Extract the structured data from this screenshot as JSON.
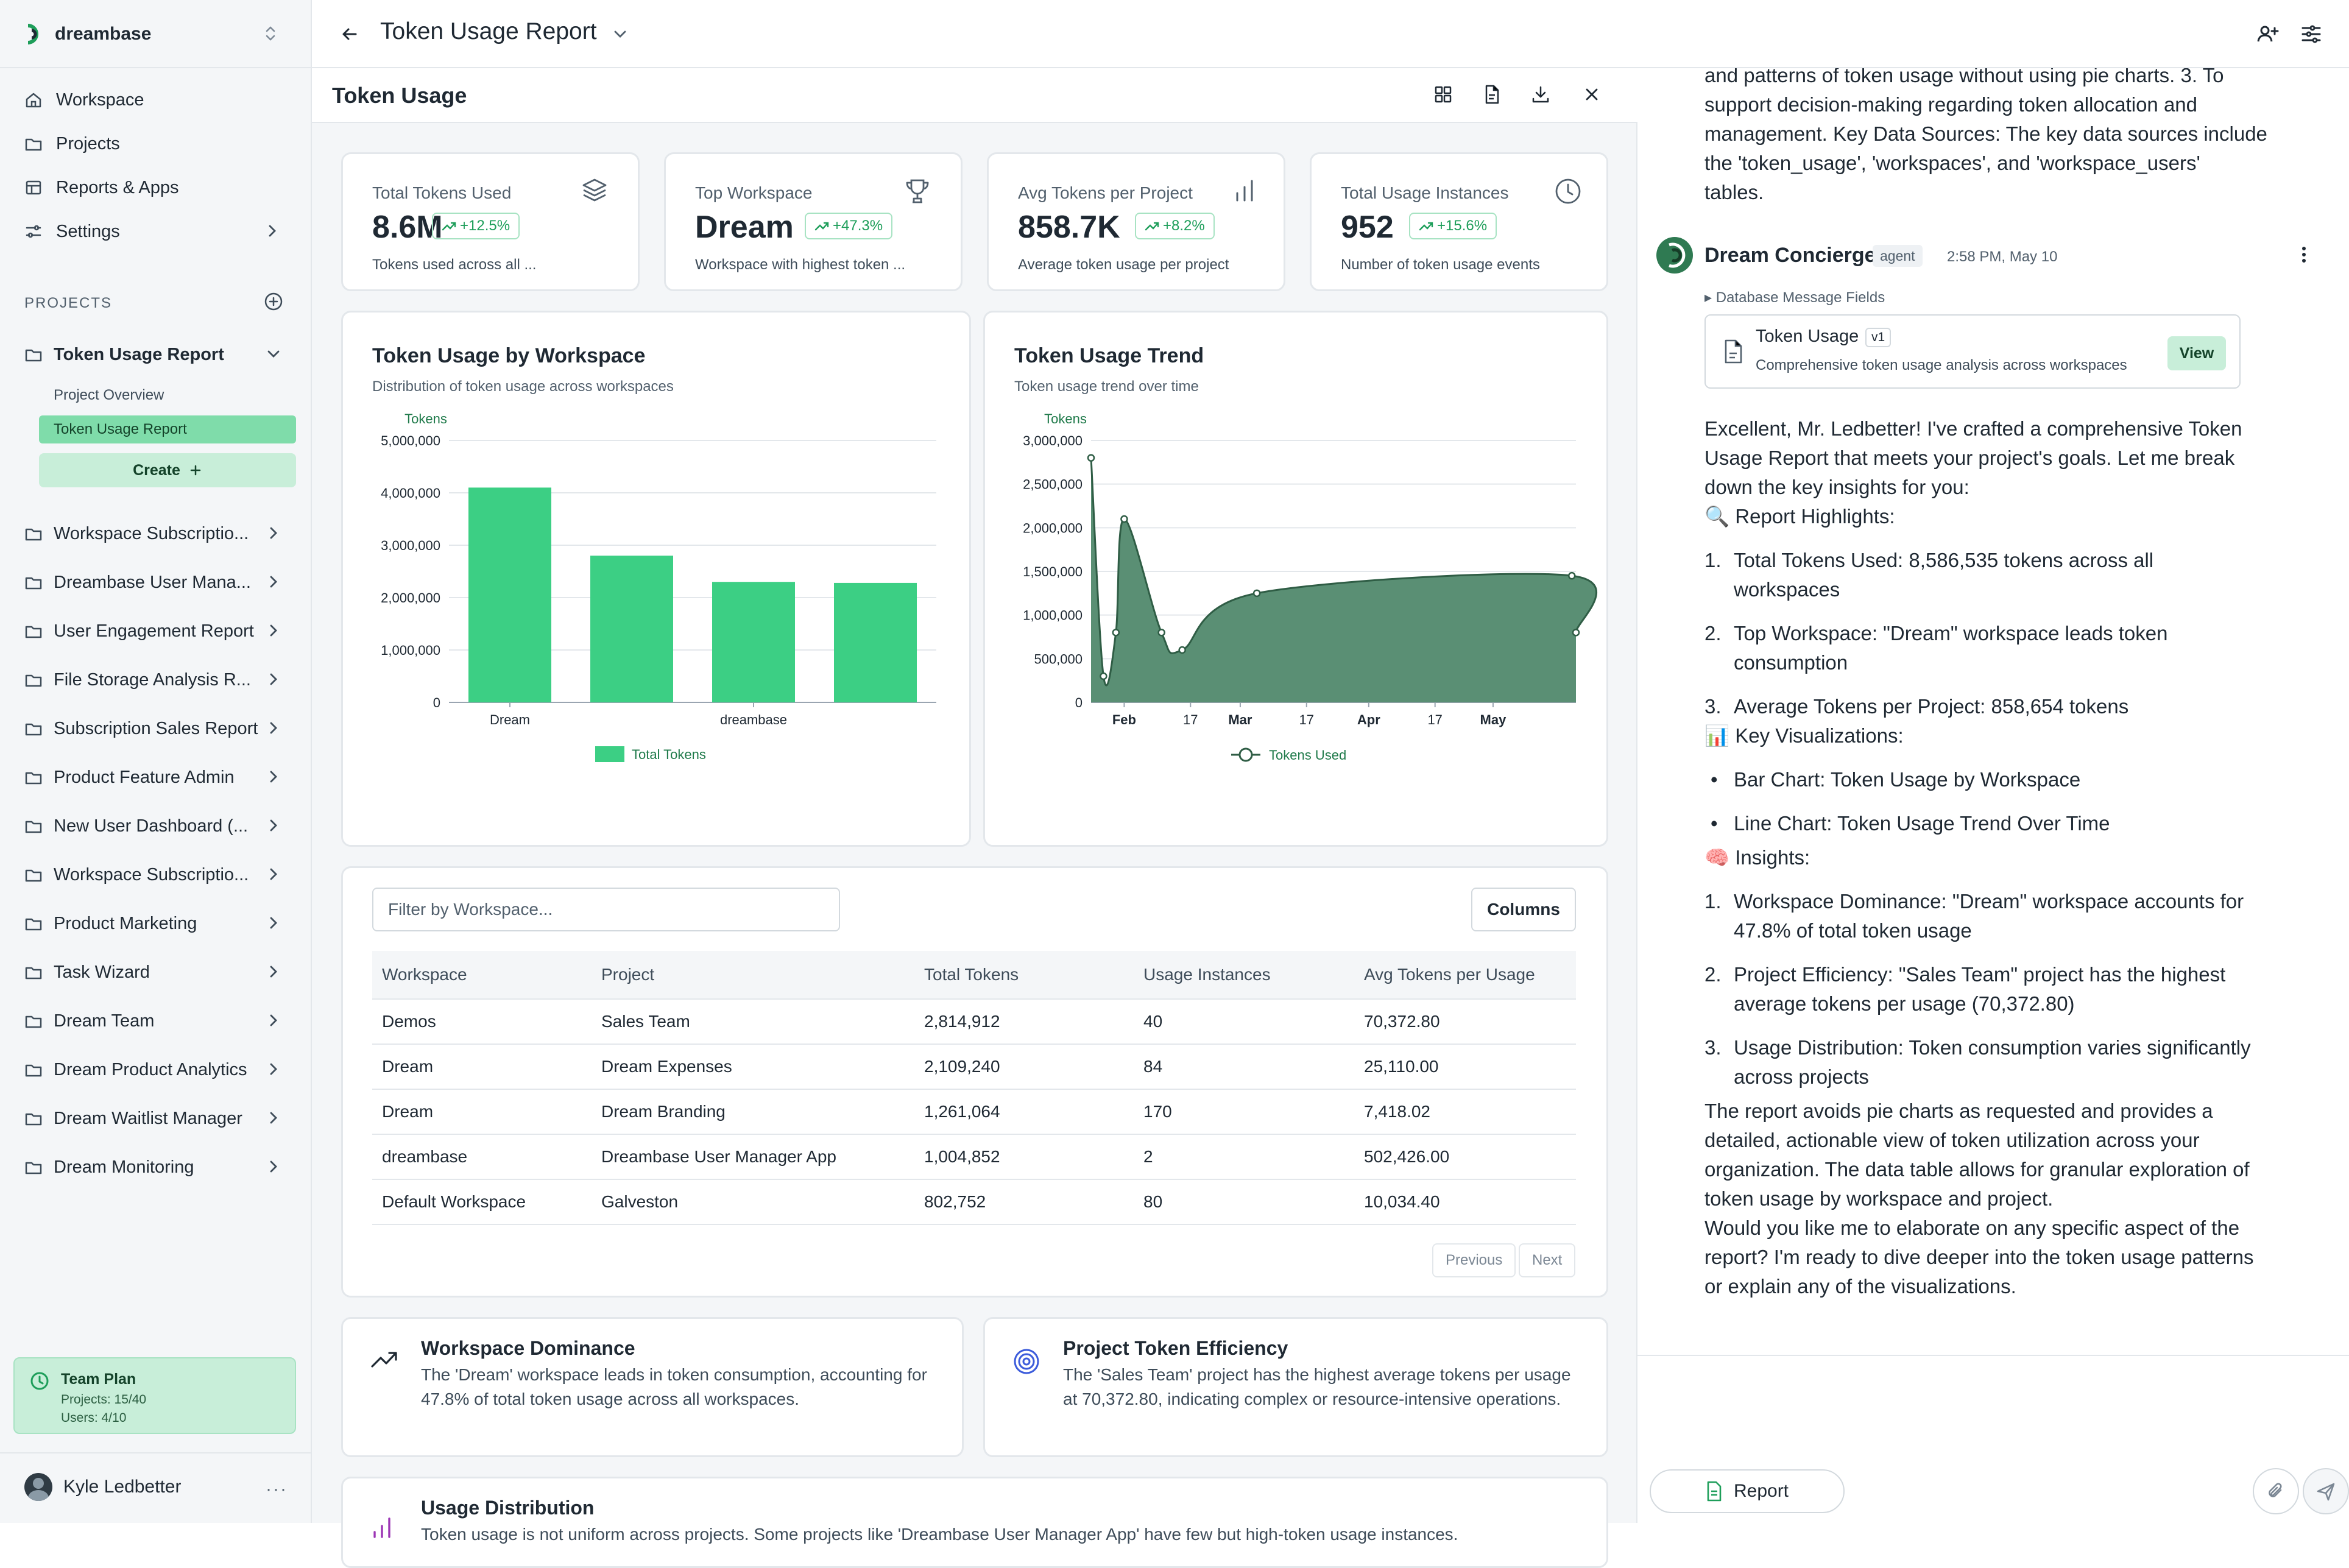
{
  "app": {
    "brand_name": "dreambase",
    "nav": [
      {
        "label": "Workspace",
        "icon": "home-icon"
      },
      {
        "label": "Projects",
        "icon": "folder-icon"
      },
      {
        "label": "Reports & Apps",
        "icon": "layout-icon"
      },
      {
        "label": "Settings",
        "icon": "sliders-icon"
      }
    ],
    "projects_label": "PROJECTS",
    "projects": [
      {
        "label": "Token Usage Report",
        "expanded": true
      },
      {
        "label": "Workspace Subscriptio..."
      },
      {
        "label": "Dreambase User Mana..."
      },
      {
        "label": "User Engagement Report"
      },
      {
        "label": "File Storage Analysis R..."
      },
      {
        "label": "Subscription Sales Report"
      },
      {
        "label": "Product Feature Admin"
      },
      {
        "label": "New User Dashboard (..."
      },
      {
        "label": "Workspace Subscriptio..."
      },
      {
        "label": "Product Marketing"
      },
      {
        "label": "Task Wizard"
      },
      {
        "label": "Dream Team"
      },
      {
        "label": "Dream Product Analytics"
      },
      {
        "label": "Dream Waitlist Manager"
      },
      {
        "label": "Dream Monitoring"
      }
    ],
    "sub_items": [
      "Project Overview",
      "Token Usage Report"
    ],
    "create_label": "Create",
    "team_plan": {
      "title": "Team Plan",
      "projects": "Projects: 15/40",
      "users": "Users: 4/10"
    },
    "user_name": "Kyle Ledbetter",
    "user_more": "···"
  },
  "header": {
    "title": "Token Usage Report"
  },
  "report": {
    "title": "Token Usage",
    "kpis": [
      {
        "label": "Total Tokens Used",
        "value": "8.6M",
        "change": "+12.5%",
        "desc": "Tokens used across all ...",
        "icon": "layers-icon"
      },
      {
        "label": "Top Workspace",
        "value": "Dream",
        "change": "+47.3%",
        "desc": "Workspace with highest token ...",
        "icon": "trophy-icon"
      },
      {
        "label": "Avg Tokens per Project",
        "value": "858.7K",
        "change": "+8.2%",
        "desc": "Average token usage per project",
        "icon": "bar-chart-icon"
      },
      {
        "label": "Total Usage Instances",
        "value": "952",
        "change": "+15.6%",
        "desc": "Number of token usage events",
        "icon": "clock-icon"
      }
    ],
    "bar_chart": {
      "title": "Token Usage by Workspace",
      "subtitle": "Distribution of token usage across workspaces"
    },
    "line_chart": {
      "title": "Token Usage Trend",
      "subtitle": "Token usage trend over time"
    },
    "table": {
      "filter_placeholder": "Filter by Workspace...",
      "columns_label": "Columns",
      "headers": [
        "Workspace",
        "Project",
        "Total Tokens",
        "Usage Instances",
        "Avg Tokens per Usage"
      ],
      "rows": [
        [
          "Demos",
          "Sales Team",
          "2,814,912",
          "40",
          "70,372.80"
        ],
        [
          "Dream",
          "Dream Expenses",
          "2,109,240",
          "84",
          "25,110.00"
        ],
        [
          "Dream",
          "Dream Branding",
          "1,261,064",
          "170",
          "7,418.02"
        ],
        [
          "dreambase",
          "Dreambase User Manager App",
          "1,004,852",
          "2",
          "502,426.00"
        ],
        [
          "Default Workspace",
          "Galveston",
          "802,752",
          "80",
          "10,034.40"
        ]
      ],
      "prev_label": "Previous",
      "next_label": "Next"
    },
    "insights": [
      {
        "title": "Workspace Dominance",
        "text": "The 'Dream' workspace leads in token consumption, accounting for 47.8% of total token usage across all workspaces.",
        "icon": "trending-up-icon"
      },
      {
        "title": "Project Token Efficiency",
        "text": "The 'Sales Team' project has the highest average tokens per usage at 70,372.80, indicating complex or resource-intensive operations.",
        "icon": "target-icon"
      },
      {
        "title": "Usage Distribution",
        "text": "Token usage is not uniform across projects. Some projects like 'Dreambase User Manager App' have few but high-token usage instances.",
        "icon": "signal-icon"
      }
    ]
  },
  "chart_data": [
    {
      "type": "bar",
      "title": "Token Usage by Workspace",
      "subtitle": "Distribution of token usage across workspaces",
      "ylabel": "Tokens",
      "categories": [
        "Dream",
        "",
        "dreambase",
        ""
      ],
      "series": [
        {
          "name": "Total Tokens",
          "values": [
            4100000,
            2800000,
            2300000,
            2280000
          ]
        }
      ],
      "yticks": [
        "0",
        "1,000,000",
        "2,000,000",
        "3,000,000",
        "4,000,000",
        "5,000,000"
      ],
      "ylim": [
        0,
        5000000
      ],
      "grid": true,
      "legend": "bottom",
      "color": "#3ccf84"
    },
    {
      "type": "area",
      "title": "Token Usage Trend",
      "subtitle": "Token usage trend over time",
      "ylabel": "Tokens",
      "xticks": [
        "Feb",
        "17",
        "Mar",
        "17",
        "Apr",
        "17",
        "May"
      ],
      "x": [
        "Jan 24",
        "Jan 27",
        "Jan 30",
        "Feb 1",
        "Feb 10",
        "Feb 15",
        "Mar 5",
        "May 20",
        "May 21"
      ],
      "series": [
        {
          "name": "Tokens Used",
          "values": [
            2800000,
            300000,
            800000,
            2100000,
            800000,
            600000,
            1250000,
            1450000,
            800000
          ]
        }
      ],
      "yticks": [
        "0",
        "500,000",
        "1,000,000",
        "1,500,000",
        "2,000,000",
        "2,500,000",
        "3,000,000"
      ],
      "ylim": [
        0,
        3000000
      ],
      "grid": true,
      "legend": "bottom",
      "color": "#5a8f74"
    }
  ],
  "chat": {
    "intro_lines": [
      "and patterns of token usage without using pie charts. 3. To",
      "support decision-making regarding token allocation and",
      "management. Key Data Sources: The key data sources include",
      "the 'token_usage', 'workspaces', and 'workspace_users'",
      "tables."
    ],
    "author": "Dream Concierge",
    "tag": "agent",
    "time": "2:58 PM, May 10",
    "db_fields": "▸ Database Message Fields",
    "artifact": {
      "title": "Token Usage",
      "version": "v1",
      "desc": "Comprehensive token usage analysis across workspaces",
      "view_label": "View"
    },
    "para1": [
      "Excellent, Mr. Ledbetter! I've crafted a comprehensive Token",
      "Usage Report that meets your project's goals. Let me break",
      "down the key insights for you:"
    ],
    "highlights_heading": "🔍 Report Highlights:",
    "highlights": [
      [
        "Total Tokens Used: 8,586,535 tokens across all",
        "workspaces"
      ],
      [
        "Top Workspace: \"Dream\" workspace leads token",
        "consumption"
      ],
      [
        "Average Tokens per Project: 858,654 tokens"
      ]
    ],
    "viz_heading": "📊 Key Visualizations:",
    "viz": [
      "Bar Chart: Token Usage by Workspace",
      "Line Chart: Token Usage Trend Over Time"
    ],
    "insights_heading": "🧠 Insights:",
    "insights": [
      [
        "Workspace Dominance: \"Dream\" workspace accounts for",
        "47.8% of total token usage"
      ],
      [
        "Project Efficiency: \"Sales Team\" project has the highest",
        "average tokens per usage (70,372.80)"
      ],
      [
        "Usage Distribution: Token consumption varies significantly",
        "across projects"
      ]
    ],
    "closing": [
      "The report avoids pie charts as requested and provides a",
      "detailed, actionable view of token utilization across your",
      "organization. The data table allows for granular exploration of",
      "token usage by workspace and project.",
      "Would you like me to elaborate on any specific aspect of the",
      "report? I'm ready to dive deeper into the token usage patterns",
      "or explain any of the visualizations."
    ],
    "report_chip": "Report"
  }
}
